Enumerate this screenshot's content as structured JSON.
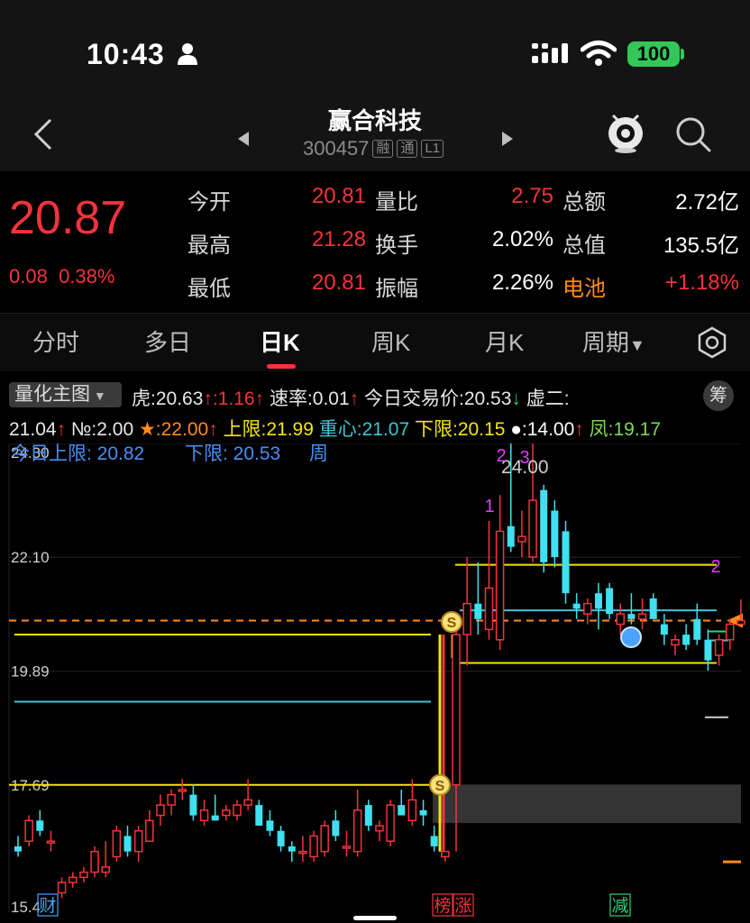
{
  "status_bar": {
    "time": "10:43",
    "battery": "100",
    "icons": [
      "person-icon",
      "signal-icon",
      "wifi-icon",
      "battery-icon"
    ]
  },
  "header": {
    "stock_name": "赢合科技",
    "stock_code": "300457",
    "tags": [
      "融",
      "通",
      "L1"
    ],
    "icons": [
      "back-icon",
      "prev-stock-icon",
      "next-stock-icon",
      "robot-icon",
      "search-icon"
    ]
  },
  "quote": {
    "price": "20.87",
    "change": "0.08",
    "change_pct": "0.38%",
    "rows": [
      [
        {
          "label": "今开",
          "value": "20.81",
          "color": "red"
        },
        {
          "label": "量比",
          "value": "2.75",
          "color": "red"
        },
        {
          "label": "总额",
          "value": "2.72亿",
          "color": "white"
        }
      ],
      [
        {
          "label": "最高",
          "value": "21.28",
          "color": "red"
        },
        {
          "label": "换手",
          "value": "2.02%",
          "color": "white"
        },
        {
          "label": "总值",
          "value": "135.5亿",
          "color": "white"
        }
      ],
      [
        {
          "label": "最低",
          "value": "20.81",
          "color": "red"
        },
        {
          "label": "振幅",
          "value": "2.26%",
          "color": "white"
        },
        {
          "label": "电池",
          "value": "+1.18%",
          "color": "red",
          "label_color": "orange"
        }
      ]
    ]
  },
  "tabs": {
    "items": [
      "分时",
      "多日",
      "日K",
      "周K",
      "月K",
      "周期"
    ],
    "active": "日K",
    "settings_icon": "hexagon-gear-icon"
  },
  "indicators": {
    "main_selector": "量化主图",
    "row1": [
      {
        "text": "虎:20.63",
        "color": "#e8e8e8"
      },
      {
        "text": "↑",
        "color": "#f4333c"
      },
      {
        "text": ":1.16",
        "color": "#f4333c"
      },
      {
        "text": "↑",
        "color": "#f4333c"
      },
      {
        "text": " 速率:0.01",
        "color": "#e8e8e8"
      },
      {
        "text": "↑",
        "color": "#f4333c"
      },
      {
        "text": " 今日交易价:20.53",
        "color": "#e8e8e8"
      },
      {
        "text": "↓",
        "color": "#2bd46b"
      },
      {
        "text": " 虚二:",
        "color": "#e8e8e8"
      }
    ],
    "chou_button": "筹",
    "row2": [
      {
        "text": "21.04",
        "color": "#e8e8e8"
      },
      {
        "text": "↑",
        "color": "#f4333c"
      },
      {
        "text": " №:2.00 ",
        "color": "#e8e8e8"
      },
      {
        "text": "★",
        "color": "#ff8c1a"
      },
      {
        "text": ":22.00",
        "color": "#ff8c1a"
      },
      {
        "text": "↑",
        "color": "#f4333c"
      },
      {
        "text": " 上限:21.99 ",
        "color": "#f5e50a"
      },
      {
        "text": "重心:21.07 ",
        "color": "#3fc6d4"
      },
      {
        "text": "下限:20.15 ",
        "color": "#f5e50a"
      },
      {
        "text": "●:14.00",
        "color": "#ffffff"
      },
      {
        "text": "↑",
        "color": "#f4333c"
      },
      {
        "text": " 凤:19.17",
        "color": "#7ed957"
      }
    ]
  },
  "chart_data": {
    "type": "candlestick",
    "y_labels": [
      "24.30",
      "22.10",
      "19.89",
      "17.69",
      "15.4"
    ],
    "overlay_text": {
      "today_upper": "今日上限: 20.82",
      "today_lower": "下限: 20.53",
      "period": "周",
      "peak_label": "24.00"
    },
    "markers": {
      "wave": [
        "1",
        "2",
        "3",
        "2"
      ],
      "bottom": [
        "财",
        "榜",
        "涨",
        "减"
      ],
      "coin": "S"
    },
    "lines": {
      "upper": 21.99,
      "center": 21.07,
      "lower": 20.15,
      "dash": 20.87,
      "old_upper": 20.6,
      "old_center": 19.3,
      "old_lower": 17.69,
      "right_upper": 21.95,
      "right_lower": 20.05
    },
    "colors": {
      "up": "#f4333c",
      "down": "#3fe0ef",
      "ma": "#f5e50a",
      "center": "#3fc6d4",
      "dash": "#ff8c1a"
    },
    "candles": [
      {
        "o": 16.5,
        "h": 16.7,
        "l": 16.3,
        "c": 16.4
      },
      {
        "o": 16.6,
        "h": 17.1,
        "l": 16.5,
        "c": 17.0
      },
      {
        "o": 17.0,
        "h": 17.2,
        "l": 16.7,
        "c": 16.8
      },
      {
        "o": 16.6,
        "h": 16.8,
        "l": 16.4,
        "c": 16.6
      },
      {
        "o": 15.6,
        "h": 15.9,
        "l": 15.5,
        "c": 15.8
      },
      {
        "o": 15.8,
        "h": 16.0,
        "l": 15.7,
        "c": 15.9
      },
      {
        "o": 15.9,
        "h": 16.1,
        "l": 15.8,
        "c": 16.0
      },
      {
        "o": 16.0,
        "h": 16.5,
        "l": 15.9,
        "c": 16.4
      },
      {
        "o": 16.0,
        "h": 16.6,
        "l": 15.9,
        "c": 16.1
      },
      {
        "o": 16.3,
        "h": 16.9,
        "l": 16.2,
        "c": 16.8
      },
      {
        "o": 16.7,
        "h": 16.9,
        "l": 16.3,
        "c": 16.4
      },
      {
        "o": 16.4,
        "h": 16.9,
        "l": 16.2,
        "c": 16.8
      },
      {
        "o": 16.6,
        "h": 17.2,
        "l": 16.6,
        "c": 17.0
      },
      {
        "o": 17.1,
        "h": 17.5,
        "l": 16.9,
        "c": 17.3
      },
      {
        "o": 17.3,
        "h": 17.6,
        "l": 17.1,
        "c": 17.5
      },
      {
        "o": 17.6,
        "h": 17.8,
        "l": 17.4,
        "c": 17.6
      },
      {
        "o": 17.5,
        "h": 17.7,
        "l": 17.0,
        "c": 17.1
      },
      {
        "o": 17.0,
        "h": 17.4,
        "l": 16.9,
        "c": 17.2
      },
      {
        "o": 17.1,
        "h": 17.5,
        "l": 17.0,
        "c": 17.0
      },
      {
        "o": 17.1,
        "h": 17.3,
        "l": 17.0,
        "c": 17.2
      },
      {
        "o": 17.1,
        "h": 17.4,
        "l": 17.0,
        "c": 17.3
      },
      {
        "o": 17.3,
        "h": 17.8,
        "l": 17.2,
        "c": 17.4
      },
      {
        "o": 17.3,
        "h": 17.4,
        "l": 16.9,
        "c": 16.9
      },
      {
        "o": 17.0,
        "h": 17.2,
        "l": 16.7,
        "c": 16.8
      },
      {
        "o": 16.8,
        "h": 16.9,
        "l": 16.4,
        "c": 16.5
      },
      {
        "o": 16.5,
        "h": 16.6,
        "l": 16.2,
        "c": 16.4
      },
      {
        "o": 16.4,
        "h": 16.7,
        "l": 16.2,
        "c": 16.4
      },
      {
        "o": 16.3,
        "h": 16.8,
        "l": 16.2,
        "c": 16.7
      },
      {
        "o": 16.4,
        "h": 17.0,
        "l": 16.3,
        "c": 16.9
      },
      {
        "o": 17.0,
        "h": 17.2,
        "l": 16.6,
        "c": 16.7
      },
      {
        "o": 16.5,
        "h": 16.8,
        "l": 16.3,
        "c": 16.5
      },
      {
        "o": 16.4,
        "h": 17.6,
        "l": 16.3,
        "c": 17.2
      },
      {
        "o": 17.3,
        "h": 17.4,
        "l": 16.8,
        "c": 16.9
      },
      {
        "o": 16.8,
        "h": 17.0,
        "l": 16.6,
        "c": 16.9
      },
      {
        "o": 16.6,
        "h": 17.4,
        "l": 16.5,
        "c": 17.3
      },
      {
        "o": 17.3,
        "h": 17.6,
        "l": 17.1,
        "c": 17.1
      },
      {
        "o": 17.0,
        "h": 17.8,
        "l": 16.9,
        "c": 17.4
      },
      {
        "o": 17.2,
        "h": 17.4,
        "l": 16.9,
        "c": 17.1
      },
      {
        "o": 16.7,
        "h": 16.9,
        "l": 16.4,
        "c": 16.5
      },
      {
        "o": 16.3,
        "h": 16.4,
        "l": 16.2,
        "c": 16.4
      },
      {
        "o": 17.69,
        "h": 20.7,
        "l": 16.4,
        "c": 20.6
      },
      {
        "o": 20.6,
        "h": 22.1,
        "l": 20.0,
        "c": 21.2
      },
      {
        "o": 21.2,
        "h": 22.0,
        "l": 20.6,
        "c": 20.9
      },
      {
        "o": 20.7,
        "h": 22.8,
        "l": 20.5,
        "c": 21.5
      },
      {
        "o": 20.5,
        "h": 23.3,
        "l": 20.3,
        "c": 22.6
      },
      {
        "o": 22.7,
        "h": 24.3,
        "l": 22.2,
        "c": 22.3
      },
      {
        "o": 22.4,
        "h": 23.0,
        "l": 22.1,
        "c": 22.5
      },
      {
        "o": 22.1,
        "h": 24.3,
        "l": 22.0,
        "c": 23.2
      },
      {
        "o": 23.4,
        "h": 23.5,
        "l": 21.8,
        "c": 22.0
      },
      {
        "o": 23.0,
        "h": 23.2,
        "l": 21.9,
        "c": 22.1
      },
      {
        "o": 22.6,
        "h": 22.8,
        "l": 21.2,
        "c": 21.4
      },
      {
        "o": 21.2,
        "h": 21.4,
        "l": 20.9,
        "c": 21.1
      },
      {
        "o": 21.0,
        "h": 21.3,
        "l": 20.8,
        "c": 21.2
      },
      {
        "o": 21.4,
        "h": 21.6,
        "l": 20.7,
        "c": 21.1
      },
      {
        "o": 21.5,
        "h": 21.6,
        "l": 20.9,
        "c": 21.0
      },
      {
        "o": 20.8,
        "h": 21.2,
        "l": 20.6,
        "c": 21.0
      },
      {
        "o": 21.0,
        "h": 21.4,
        "l": 20.8,
        "c": 20.9
      },
      {
        "o": 20.9,
        "h": 21.3,
        "l": 20.7,
        "c": 21.0
      },
      {
        "o": 21.3,
        "h": 21.4,
        "l": 20.9,
        "c": 20.9
      },
      {
        "o": 20.8,
        "h": 21.0,
        "l": 20.4,
        "c": 20.6
      },
      {
        "o": 20.4,
        "h": 20.6,
        "l": 20.2,
        "c": 20.5
      },
      {
        "o": 20.6,
        "h": 20.8,
        "l": 20.3,
        "c": 20.4
      },
      {
        "o": 20.9,
        "h": 21.2,
        "l": 20.4,
        "c": 20.5
      },
      {
        "o": 20.5,
        "h": 20.7,
        "l": 19.9,
        "c": 20.1
      },
      {
        "o": 20.2,
        "h": 20.6,
        "l": 20.0,
        "c": 20.5
      },
      {
        "o": 20.5,
        "h": 20.9,
        "l": 20.3,
        "c": 20.8
      },
      {
        "o": 20.8,
        "h": 21.28,
        "l": 20.81,
        "c": 20.87
      }
    ]
  }
}
